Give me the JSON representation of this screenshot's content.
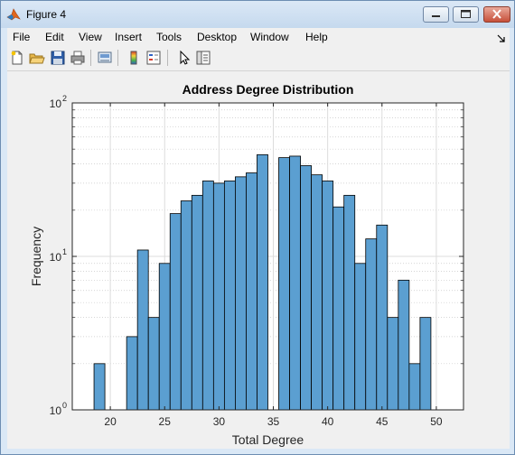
{
  "window": {
    "title": "Figure 4"
  },
  "menu": {
    "items": [
      "File",
      "Edit",
      "View",
      "Insert",
      "Tools",
      "Desktop",
      "Window",
      "Help"
    ]
  },
  "toolbar": {
    "icons": [
      "new-figure-icon",
      "open-file-icon",
      "save-icon",
      "print-icon",
      "link-plot-icon",
      "insert-colorbar-icon",
      "insert-legend-icon",
      "edit-plot-icon",
      "property-inspector-icon"
    ]
  },
  "colors": {
    "bar_fill": "#5b9fd1",
    "bar_edge": "#000000",
    "axes_bg": "#ffffff",
    "figure_bg": "#f0f0f0"
  },
  "chart_data": {
    "type": "bar",
    "title": "Address Degree Distribution",
    "xlabel": "Total Degree",
    "ylabel": "Frequency",
    "xlim": [
      16.5,
      52.5
    ],
    "ylim": [
      1,
      100
    ],
    "yscale": "log",
    "grid": true,
    "minor_grid": true,
    "xticks": [
      "20",
      "25",
      "30",
      "35",
      "40",
      "45",
      "50"
    ],
    "yticks": [
      {
        "base": "10",
        "exp": "0"
      },
      {
        "base": "10",
        "exp": "1"
      },
      {
        "base": "10",
        "exp": "2"
      }
    ],
    "bin_width": 1,
    "bins": [
      {
        "x": 19,
        "count": 2
      },
      {
        "x": 22,
        "count": 3
      },
      {
        "x": 23,
        "count": 11
      },
      {
        "x": 24,
        "count": 4
      },
      {
        "x": 25,
        "count": 9
      },
      {
        "x": 26,
        "count": 19
      },
      {
        "x": 27,
        "count": 23
      },
      {
        "x": 28,
        "count": 25
      },
      {
        "x": 29,
        "count": 31
      },
      {
        "x": 30,
        "count": 30
      },
      {
        "x": 31,
        "count": 31
      },
      {
        "x": 32,
        "count": 33
      },
      {
        "x": 33,
        "count": 35
      },
      {
        "x": 34,
        "count": 46
      },
      {
        "x": 36,
        "count": 44
      },
      {
        "x": 37,
        "count": 45
      },
      {
        "x": 38,
        "count": 39
      },
      {
        "x": 39,
        "count": 34
      },
      {
        "x": 40,
        "count": 31
      },
      {
        "x": 41,
        "count": 21
      },
      {
        "x": 42,
        "count": 25
      },
      {
        "x": 43,
        "count": 9
      },
      {
        "x": 44,
        "count": 13
      },
      {
        "x": 45,
        "count": 16
      },
      {
        "x": 46,
        "count": 4
      },
      {
        "x": 47,
        "count": 7
      },
      {
        "x": 48,
        "count": 2
      },
      {
        "x": 49,
        "count": 4
      }
    ]
  }
}
